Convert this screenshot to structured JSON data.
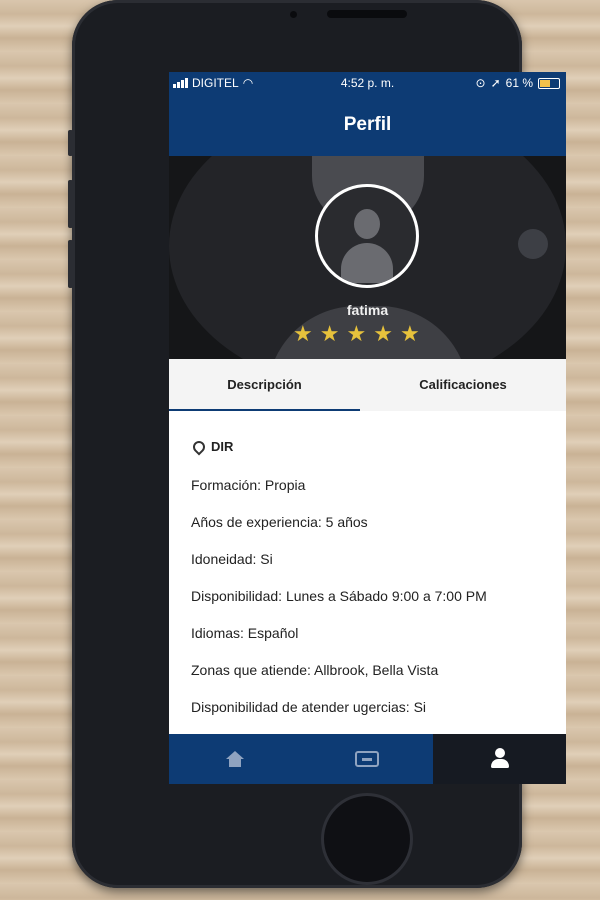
{
  "status_bar": {
    "carrier": "DIGITEL",
    "time": "4:52 p. m.",
    "battery_percent": "61 %",
    "battery_level": 0.61
  },
  "nav": {
    "title": "Perfil"
  },
  "profile": {
    "name": "fatima",
    "rating": 5,
    "rating_max": 5
  },
  "tabs": [
    {
      "label": "Descripción",
      "active": true
    },
    {
      "label": "Calificaciones",
      "active": false
    }
  ],
  "description": {
    "location": "DIR",
    "items": [
      "Formación: Propia",
      "Años de experiencia: 5 años",
      "Idoneidad: Si",
      "Disponibilidad: Lunes a Sábado 9:00 a 7:00 PM",
      "Idiomas: Español",
      "Zonas que atiende: Allbrook, Bella Vista",
      "Disponibilidad de atender ugercias: Si"
    ]
  },
  "tabbar": {
    "items": [
      {
        "icon": "home-icon"
      },
      {
        "icon": "inbox-icon"
      },
      {
        "icon": "profile-icon",
        "active": true
      }
    ]
  },
  "colors": {
    "primary": "#0d3b74",
    "star": "#e7c23c",
    "active_tab_bg": "#161a22"
  }
}
